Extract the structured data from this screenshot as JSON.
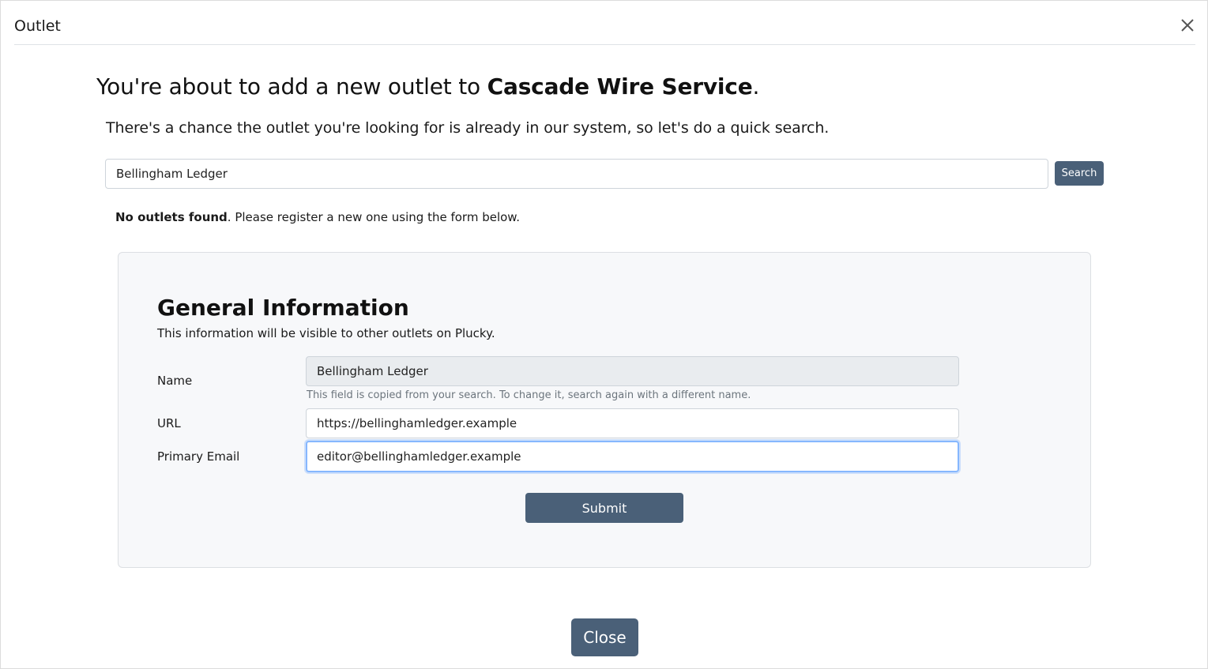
{
  "modal": {
    "title": "Outlet",
    "close_icon": "close-icon"
  },
  "intro": {
    "headline_prefix": "You're about to add a new outlet to ",
    "organization": "Cascade Wire Service",
    "headline_suffix": ".",
    "subline": "There's a chance the outlet you're looking for is already in our system, so let's do a quick search."
  },
  "search": {
    "value": "Bellingham Ledger",
    "button_label": "Search"
  },
  "result": {
    "bold": "No outlets found",
    "text": ". Please register a new one using the form below."
  },
  "form": {
    "title": "General Information",
    "description": "This information will be visible to other outlets on Plucky.",
    "fields": {
      "name": {
        "label": "Name",
        "value": "Bellingham Ledger",
        "help": "This field is copied from your search. To change it, search again with a different name."
      },
      "url": {
        "label": "URL",
        "value": "https://bellinghamledger.example"
      },
      "email": {
        "label": "Primary Email",
        "value": "editor@bellinghamledger.example"
      }
    },
    "submit_label": "Submit"
  },
  "footer": {
    "close_label": "Close"
  },
  "colors": {
    "primary_button": "#4a6078",
    "panel_background": "#f7f8fa",
    "readonly_input": "#e9ecef",
    "focus_ring": "#86b7fe"
  }
}
